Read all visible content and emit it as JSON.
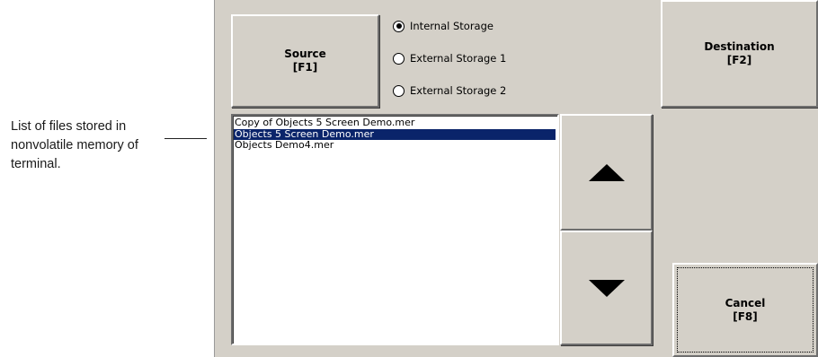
{
  "callout": {
    "lines": [
      "List of files stored in",
      "nonvolatile memory of",
      "terminal."
    ]
  },
  "source_button": {
    "line1": "Source",
    "line2": "[F1]"
  },
  "destination_button": {
    "line1": "Destination",
    "line2": "[F2]"
  },
  "cancel_button": {
    "line1": "Cancel",
    "line2": "[F8]"
  },
  "storage_options": [
    {
      "label": "Internal Storage",
      "checked": true
    },
    {
      "label": "External Storage 1",
      "checked": false
    },
    {
      "label": "External Storage 2",
      "checked": false
    }
  ],
  "files": [
    {
      "name": "Copy of Objects 5 Screen Demo.mer",
      "selected": false
    },
    {
      "name": "Objects 5 Screen Demo.mer",
      "selected": true
    },
    {
      "name": "Objects Demo4.mer",
      "selected": false
    }
  ],
  "colors": {
    "panel": "#d4d0c8",
    "selection": "#0a246a"
  },
  "icons": {
    "scroll_up": "triangle-up-icon",
    "scroll_down": "triangle-down-icon"
  }
}
